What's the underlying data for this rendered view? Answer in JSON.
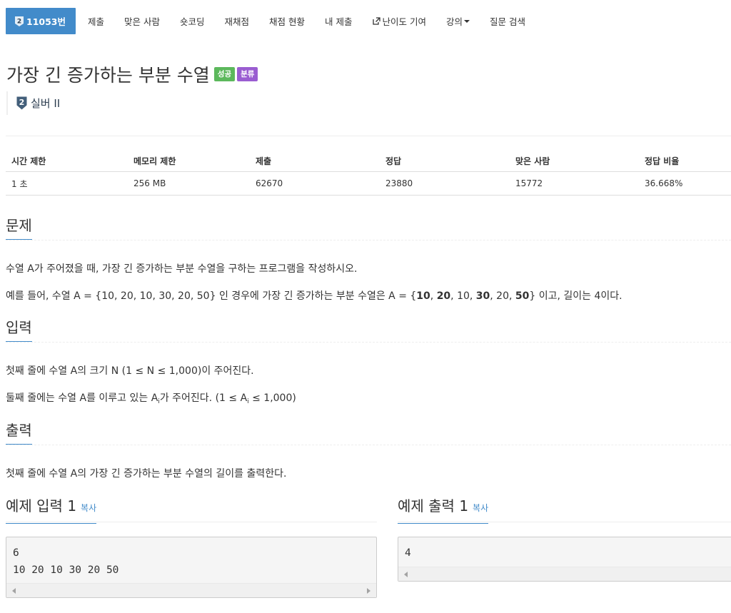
{
  "nav": {
    "problem_number": "11053번",
    "items": [
      "제출",
      "맞은 사람",
      "숏코딩",
      "재채점",
      "채점 현황",
      "내 제출",
      "난이도 기여",
      "강의",
      "질문 검색"
    ]
  },
  "problem": {
    "title": "가장 긴 증가하는 부분 수열",
    "label_success": "성공",
    "label_category": "분류",
    "tier_badge": "2",
    "tier": "실버 II"
  },
  "info_table": {
    "headers": [
      "시간 제한",
      "메모리 제한",
      "제출",
      "정답",
      "맞은 사람",
      "정답 비율"
    ],
    "values": [
      "1 초",
      "256 MB",
      "62670",
      "23880",
      "15772",
      "36.668%"
    ]
  },
  "sections": {
    "problem_heading": "문제",
    "problem_p1": "수열 A가 주어졌을 때, 가장 긴 증가하는 부분 수열을 구하는 프로그램을 작성하시오.",
    "problem_p2": {
      "part1": "예를 들어, 수열 A = {10, 20, 10, 30, 20, 50} 인 경우에 가장 긴 증가하는 부분 수열은 A = {",
      "b1": "10",
      "sep1": ", ",
      "b2": "20",
      "sep2": ", 10, ",
      "b3": "30",
      "sep3": ", 20, ",
      "b4": "50",
      "part2": "} 이고, 길이는 4이다."
    },
    "input_heading": "입력",
    "input_p1": "첫째 줄에 수열 A의 크기 N (1 ≤ N ≤ 1,000)이 주어진다.",
    "input_p2": {
      "part1": "둘째 줄에는 수열 A를 이루고 있는 A",
      "sub": "i",
      "part2": "가 주어진다. (1 ≤ A",
      "sub2": "i",
      "part3": " ≤ 1,000)"
    },
    "output_heading": "출력",
    "output_p1": "첫째 줄에 수열 A의 가장 긴 증가하는 부분 수열의 길이를 출력한다."
  },
  "examples": {
    "input_title": "예제 입력 1",
    "output_title": "예제 출력 1",
    "copy_label": "복사",
    "input_text": "6\n10 20 10 30 20 50",
    "output_text": "4"
  },
  "colors": {
    "primary": "#428bca",
    "success": "#5cb85c",
    "category": "#9a5dd1",
    "tier": "#2c3e50"
  }
}
